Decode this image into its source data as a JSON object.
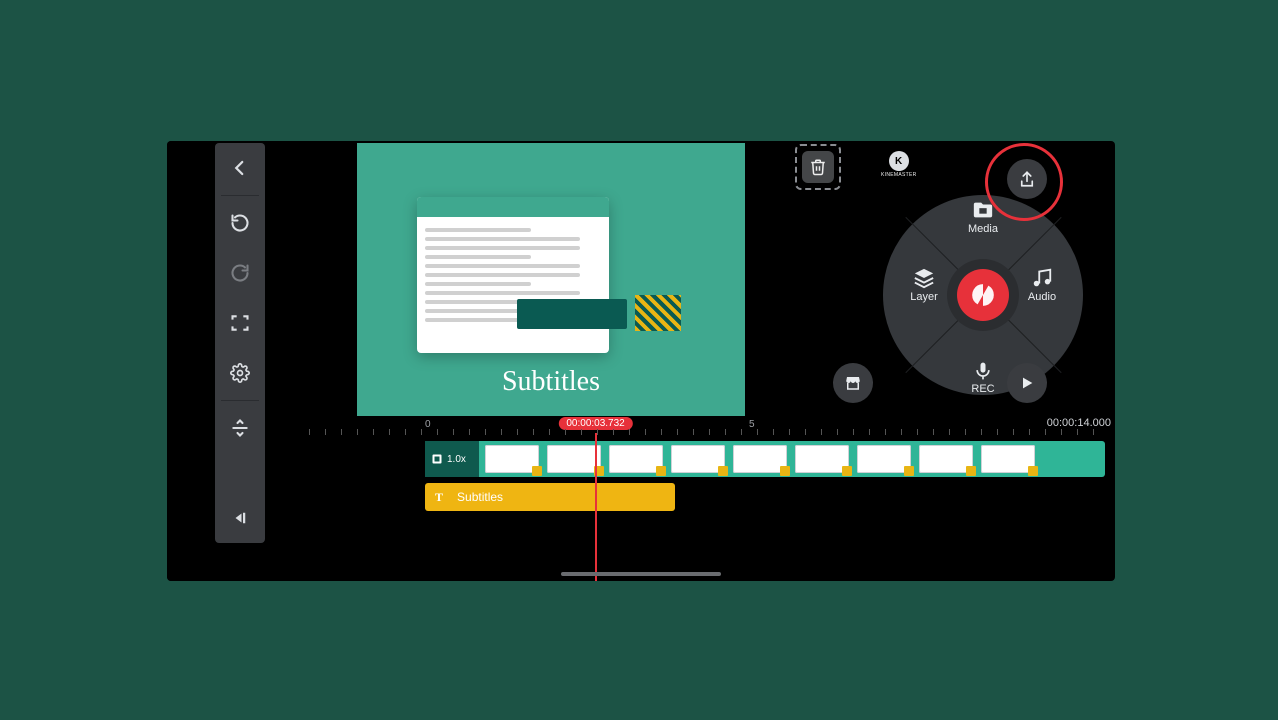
{
  "app_name": "KineMaster",
  "sidebar": {
    "back": "back",
    "undo": "undo",
    "redo": "redo",
    "fullscreen": "fullscreen",
    "settings": "settings",
    "tracks": "tracks",
    "jump_end": "jump-to-end"
  },
  "preview": {
    "subtitle_text": "Subtitles",
    "watermark": "KINEMASTER"
  },
  "wheel": {
    "media": "Media",
    "layer": "Layer",
    "audio": "Audio",
    "rec": "REC"
  },
  "corner": {
    "export": "export",
    "store": "asset-store",
    "play": "play"
  },
  "timeline": {
    "marker_0": "0",
    "marker_5": "5",
    "playhead_time": "00:00:03.732",
    "duration": "00:00:14.000",
    "playhead_position_pct": 36,
    "video_track": {
      "speed": "1.0x",
      "clip_count": 9
    },
    "text_track": {
      "icon": "T",
      "label": "Subtitles"
    }
  }
}
